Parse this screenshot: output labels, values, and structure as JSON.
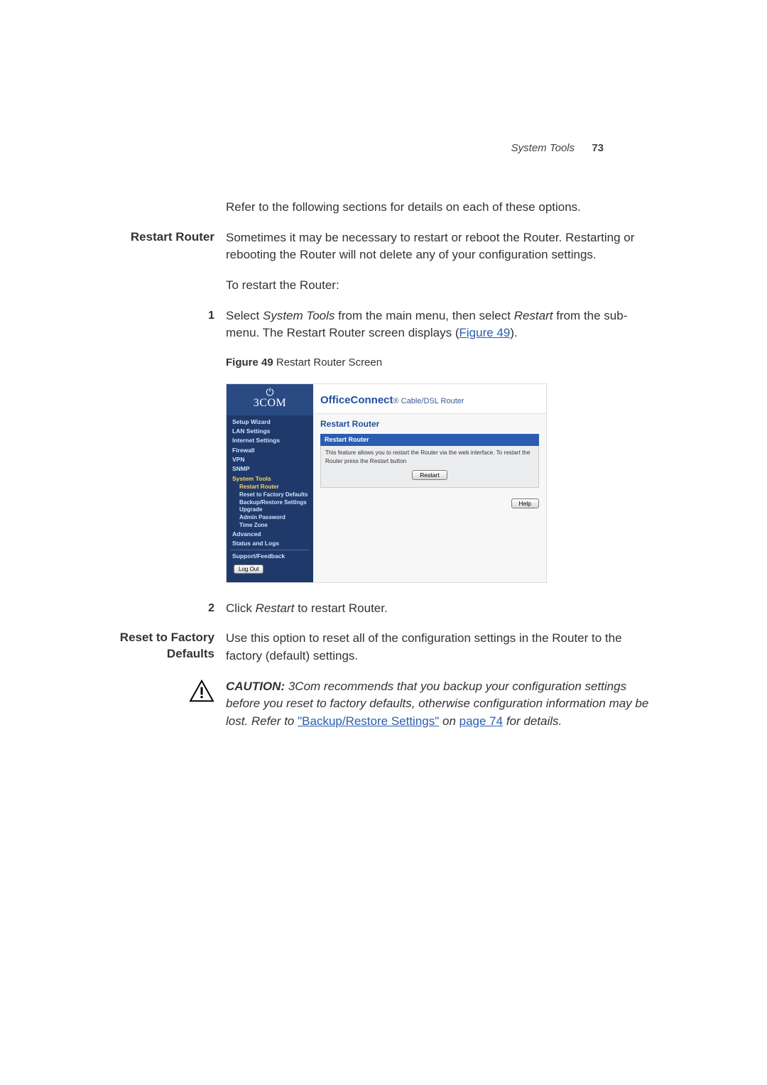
{
  "runningHead": {
    "title": "System Tools",
    "page": "73"
  },
  "intro": "Refer to the following sections for details on each of these options.",
  "s1": {
    "heading": "Restart Router",
    "p1": "Sometimes it may be necessary to restart or reboot the Router. Restarting or rebooting the Router will not delete any of your configuration settings.",
    "p2": "To restart the Router:",
    "step1num": "1",
    "step1a": "Select ",
    "step1b": "System Tools",
    "step1c": " from the main menu, then select ",
    "step1d": "Restart",
    "step1e": " from the sub-menu. The Restart Router screen displays (",
    "step1link": "Figure 49",
    "step1f": ")."
  },
  "figcap": {
    "num": "Figure 49",
    "text": "   Restart Router Screen"
  },
  "screenshot": {
    "brand": "3COM",
    "productA": "OfficeConnect",
    "productB": "® Cable/DSL Router",
    "panelTitle": "Restart Router",
    "barTitle": "Restart Router",
    "desc": "This feature allows you to restart the Router via the web interface. To restart the Router press the Restart button",
    "restartBtn": "Restart",
    "helpBtn": "Help",
    "logoutBtn": "Log Out",
    "nav": {
      "setup": "Setup Wizard",
      "lan": "LAN Settings",
      "internet": "Internet Settings",
      "firewall": "Firewall",
      "vpn": "VPN",
      "snmp": "SNMP",
      "systools": "System Tools",
      "restart": "Restart Router",
      "reset": "Reset to Factory Defaults",
      "backup": "Backup/Restore Settings",
      "upgrade": "Upgrade",
      "admin": "Admin Password",
      "tz": "Time Zone",
      "advanced": "Advanced",
      "status": "Status and Logs",
      "support": "Support/Feedback"
    }
  },
  "step2": {
    "num": "2",
    "a": "Click ",
    "b": "Restart",
    "c": " to restart Router."
  },
  "s2": {
    "heading": "Reset to Factory Defaults",
    "p1": "Use this option to reset all of the configuration settings in the Router to the factory (default) settings."
  },
  "caution": {
    "lead": "CAUTION:",
    "t1": " 3Com recommends that you backup your configuration settings before you reset to factory defaults, otherwise configuration information may be lost. Refer to ",
    "link1": "\"Backup/Restore Settings\"",
    "t2": " on ",
    "link2": "page 74",
    "t3": " for details."
  }
}
